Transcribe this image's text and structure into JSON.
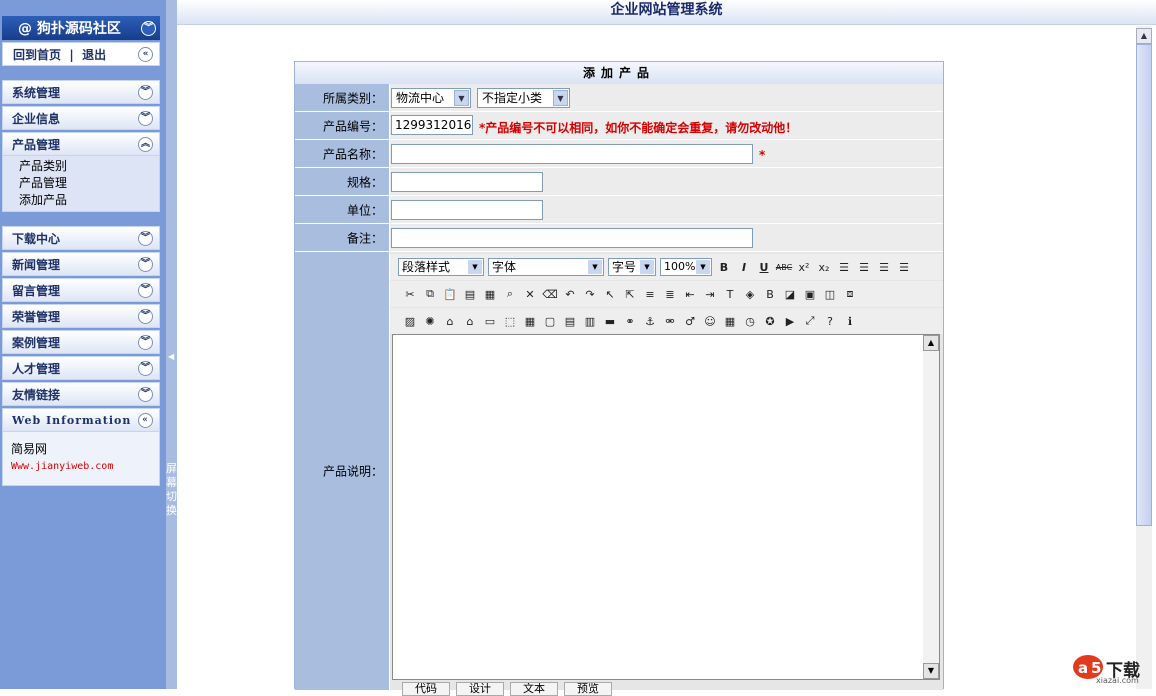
{
  "app": {
    "title": "企业网站管理系统"
  },
  "sidebar": {
    "logo": "@ 狗扑源码社区",
    "home": "回到首页",
    "logout": "退出",
    "menus": [
      "系统管理",
      "企业信息",
      "产品管理"
    ],
    "product_sub": [
      "产品类别",
      "产品管理",
      "添加产品"
    ],
    "menus2": [
      "下载中心",
      "新闻管理",
      "留言管理",
      "荣誉管理",
      "案例管理",
      "人才管理",
      "友情链接"
    ],
    "webinfo_title": "Web Information",
    "site_name": "简易网",
    "site_url": "Www.jianyiweb.com",
    "switch_label": "屏幕切换"
  },
  "form": {
    "title": "添加产品",
    "category_label": "所属类别：",
    "category_value": "物流中心",
    "subcategory_value": "不指定小类",
    "code_label": "产品编号：",
    "code_value": "1299312016",
    "code_warning": "*产品编号不可以相同，如你不能确定会重复，请勿改动他！",
    "name_label": "产品名称：",
    "required_mark": "*",
    "spec_label": "规格：",
    "unit_label": "单位：",
    "note_label": "备注：",
    "desc_label": "产品说明："
  },
  "editor": {
    "paragraph": "段落样式",
    "font": "字体",
    "size": "字号",
    "zoom": "100%",
    "tabs": [
      "代码",
      "设计",
      "文本",
      "预览"
    ]
  },
  "watermark": {
    "text": "下载",
    "url": "xiazai.com"
  },
  "colors": {
    "sidebar_bg": "#7a9bd8",
    "label_bg": "#a9bddf",
    "warning": "#d60000"
  }
}
